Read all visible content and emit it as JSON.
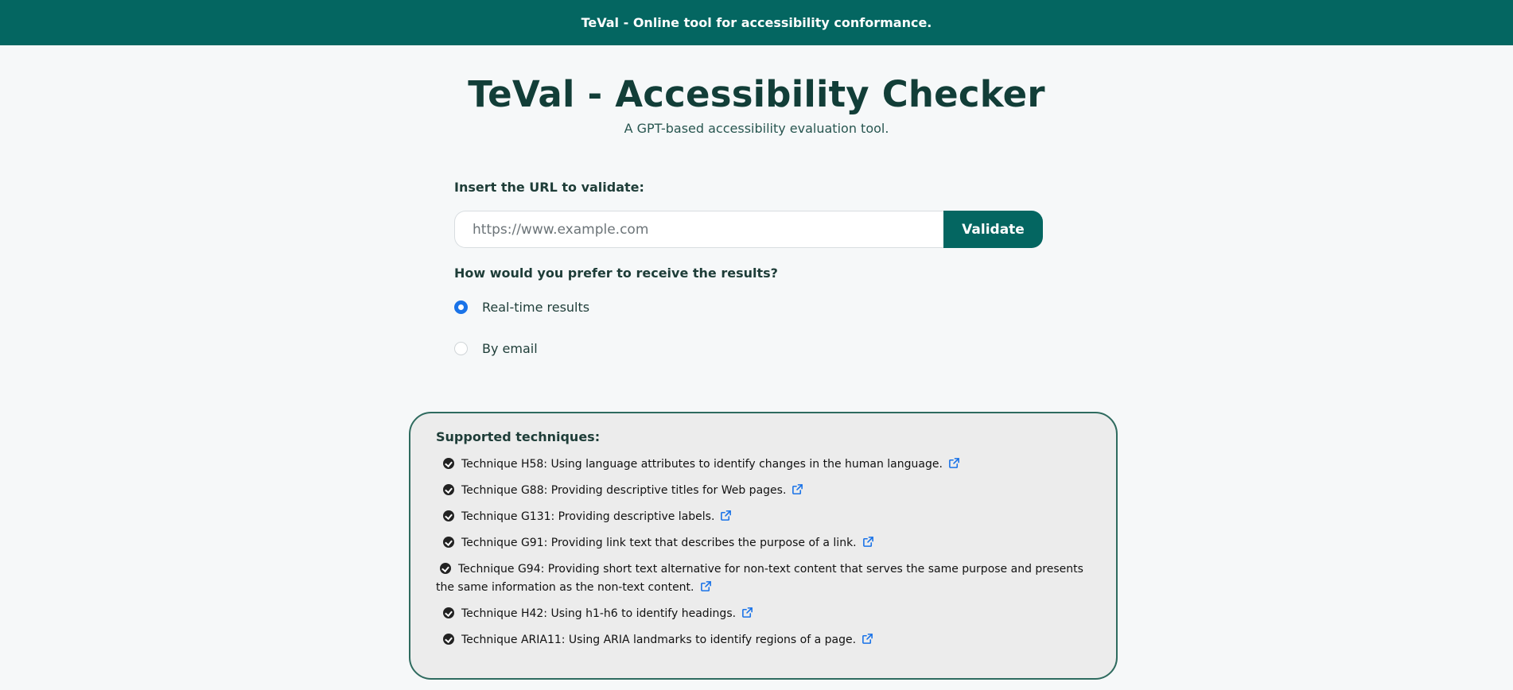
{
  "header": {
    "banner": "TeVal - Online tool for accessibility conformance."
  },
  "main": {
    "title": "TeVal - Accessibility Checker",
    "subtitle": "A GPT-based accessibility evaluation tool."
  },
  "form": {
    "url_label": "Insert the URL to validate:",
    "url_placeholder": "https://www.example.com",
    "url_value": "",
    "validate_label": "Validate",
    "results_question": "How would you prefer to receive the results?",
    "options": [
      {
        "label": "Real-time results",
        "selected": true
      },
      {
        "label": "By email",
        "selected": false
      }
    ]
  },
  "techniques": {
    "title": "Supported techniques:",
    "items": [
      "Technique H58: Using language attributes to identify changes in the human language.",
      "Technique G88: Providing descriptive titles for Web pages.",
      "Technique G131: Providing descriptive labels.",
      "Technique G91: Providing link text that describes the purpose of a link.",
      "Technique G94: Providing short text alternative for non-text content that serves the same purpose and presents the same information as the non-text content.",
      "Technique H42: Using h1-h6 to identify headings.",
      "Technique ARIA11: Using ARIA landmarks to identify regions of a page."
    ]
  },
  "colors": {
    "brand": "#046661",
    "radio_selected": "#1a73e8",
    "link_icon": "#1a73e8"
  },
  "icons": {
    "check": "check-circle-icon",
    "external": "external-link-icon"
  }
}
